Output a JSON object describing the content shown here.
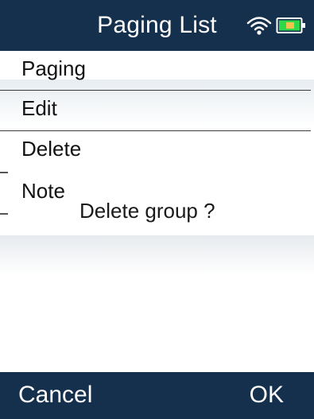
{
  "header": {
    "title": "Paging List",
    "status_icons": [
      "wifi-icon",
      "battery-icon"
    ]
  },
  "menu": {
    "items": [
      {
        "label": "Paging"
      },
      {
        "label": "Edit"
      },
      {
        "label": "Delete"
      },
      {
        "label": "Note"
      }
    ],
    "selected": "Delete"
  },
  "dialog": {
    "message": "Delete group ?"
  },
  "softkeys": {
    "left": "Cancel",
    "right": "OK"
  },
  "colors": {
    "bar_background": "#14304d",
    "text_light": "#ffffff",
    "text_dark": "#121212",
    "wifi": "#ffffff",
    "battery_fill": "#2fd84a",
    "battery_accent": "#f2c14e"
  }
}
